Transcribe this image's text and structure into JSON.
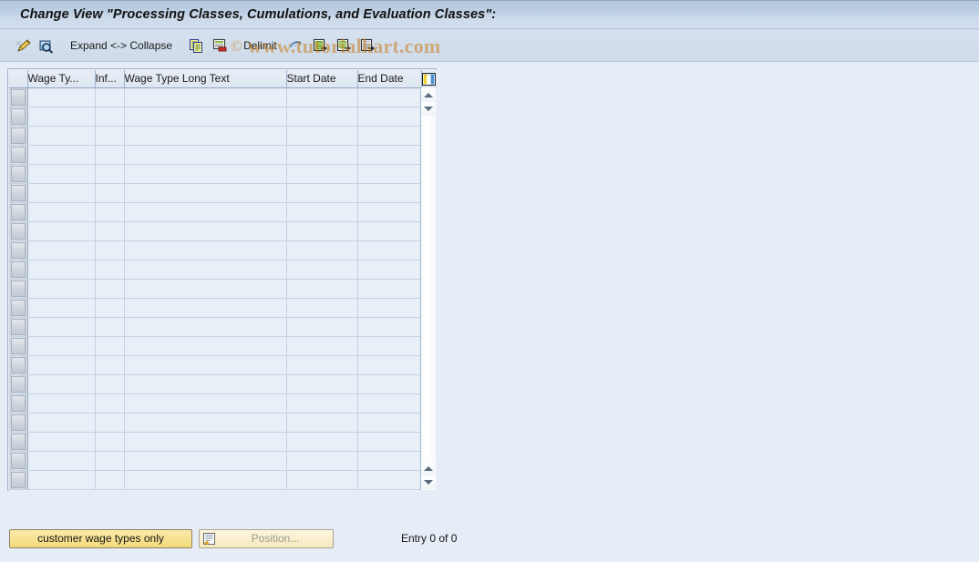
{
  "window": {
    "title": "Change View \"Processing Classes, Cumulations, and Evaluation Classes\":"
  },
  "watermark": {
    "copyright": "©",
    "text": "www.tutorialkart.com"
  },
  "toolbar": {
    "items": [
      {
        "kind": "icon",
        "name": "edit-pencil-icon",
        "label": ""
      },
      {
        "kind": "icon",
        "name": "display-magnifier-icon",
        "label": ""
      },
      {
        "kind": "text",
        "name": "expand-collapse-label",
        "label": "Expand <-> Collapse"
      },
      {
        "kind": "icon",
        "name": "copy-icon",
        "label": ""
      },
      {
        "kind": "icon",
        "name": "delete-row-icon",
        "label": ""
      },
      {
        "kind": "text",
        "name": "delimit-label",
        "label": "Delimit"
      },
      {
        "kind": "icon",
        "name": "undo-arrow-icon",
        "label": ""
      },
      {
        "kind": "icon",
        "name": "select-all-icon",
        "label": ""
      },
      {
        "kind": "icon",
        "name": "deselect-all-icon",
        "label": ""
      },
      {
        "kind": "icon",
        "name": "details-icon",
        "label": ""
      }
    ],
    "expand_collapse_label": "Expand <-> Collapse",
    "delimit_label": "Delimit"
  },
  "table": {
    "columns": [
      {
        "key": "select",
        "label": ""
      },
      {
        "key": "wage_type",
        "label": "Wage Ty..."
      },
      {
        "key": "infotype",
        "label": "Inf..."
      },
      {
        "key": "wage_type_long_text",
        "label": "Wage Type Long Text"
      },
      {
        "key": "start_date",
        "label": "Start Date"
      },
      {
        "key": "end_date",
        "label": "End Date"
      },
      {
        "key": "config",
        "label": ""
      }
    ],
    "config_icon": "column-settings-icon",
    "rows": [],
    "empty_row_count": 21
  },
  "footer": {
    "customer_wage_types_button": "customer wage types only",
    "position_button": "Position...",
    "position_icon": "position-find-icon",
    "entry_status": "Entry 0 of 0"
  },
  "colors": {
    "background": "#e6edf6",
    "titlebar_top": "#b4c7de",
    "titlebar_bottom": "#d3dff0",
    "toolbar": "#d2deec",
    "grid_cell": "#e9eff7",
    "grid_line": "#c3d2e4",
    "grid_border": "#a3b8d0",
    "button_yellow": "#f8e393",
    "watermark": "#c87814"
  }
}
